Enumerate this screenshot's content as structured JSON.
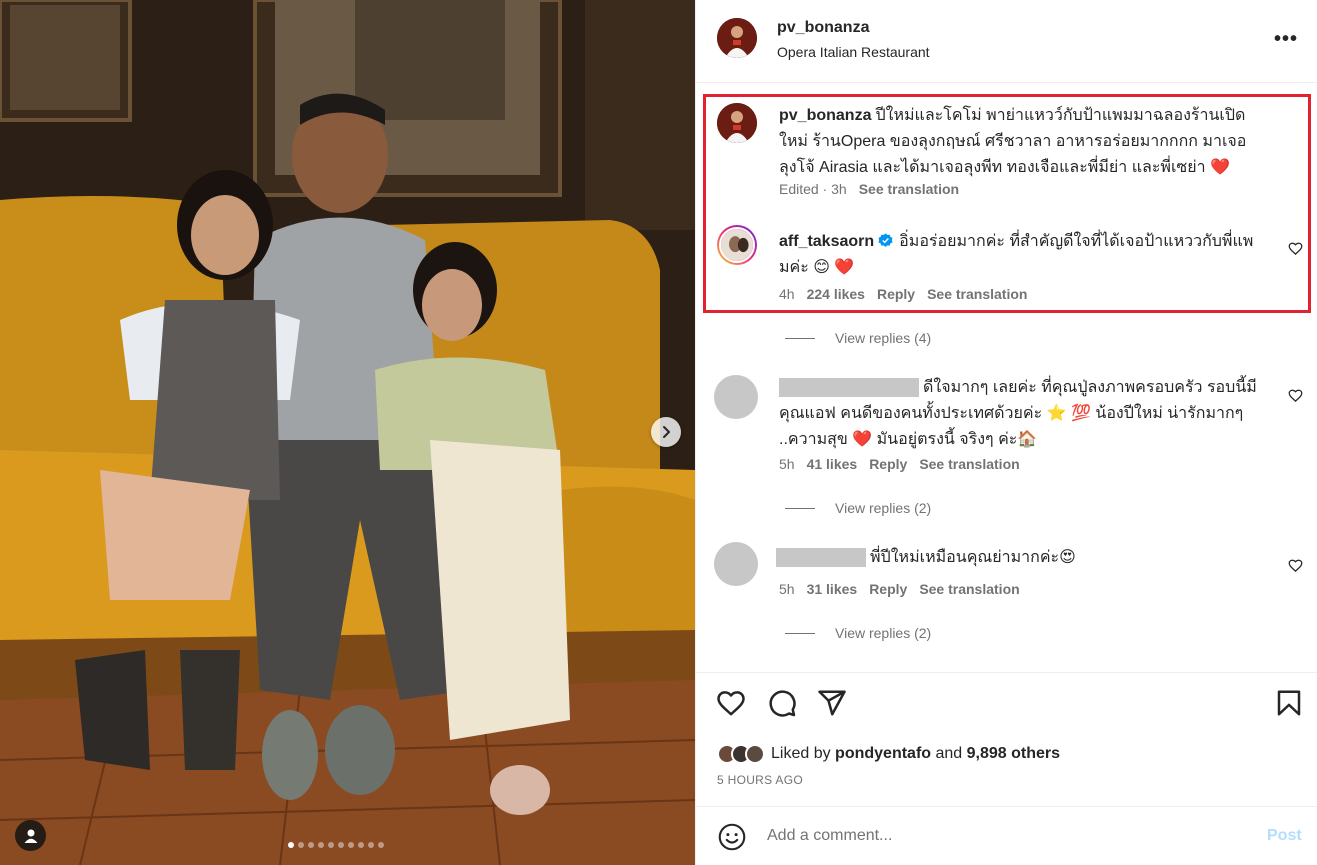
{
  "post": {
    "username": "pv_bonanza",
    "location": "Opera Italian Restaurant",
    "more_label": "•••"
  },
  "caption": {
    "username": "pv_bonanza",
    "text": "ปีใหม่และโคโม่ พาย่าแหวว์กับป้าแพมมาฉลองร้านเปิดใหม่ ร้านOpera ของลุงกฤษณ์ ศรีชวาลา อาหารอร่อยมากกกก มาเจอลุงโจ้ Airasia และได้มาเจอลุงพีท ทองเจือและพี่มีย่า และพี่เซย่า ❤️",
    "edited": "Edited · 3h",
    "translate": "See translation"
  },
  "comments": [
    {
      "username": "aff_taksaorn",
      "verified": true,
      "text": "อิ่มอร่อยมากค่ะ ที่สำคัญดีใจที่ได้เจอป้าแหววกับพี่แพมค่ะ 😊 ❤️",
      "time": "4h",
      "likes": "224 likes",
      "reply": "Reply",
      "translate": "See translation",
      "view_replies": "View replies (4)"
    },
    {
      "username": "",
      "text": "ดีใจมากๆ เลยค่ะ ที่คุณปู่ลงภาพครอบครัว รอบนี้มีคุณแอฟ คนดีของคนทั้งประเทศด้วยค่ะ ⭐ 💯 น้องปีใหม่ น่ารักมากๆ ..ความสุข ❤️ มันอยู่ตรงนี้ จริงๆ ค่ะ🏠",
      "time": "5h",
      "likes": "41 likes",
      "reply": "Reply",
      "translate": "See translation",
      "view_replies": "View replies (2)"
    },
    {
      "username": "",
      "text": "พี่ปีใหม่เหมือนคุณย่ามากค่ะ😍",
      "time": "5h",
      "likes": "31 likes",
      "reply": "Reply",
      "translate": "See translation",
      "view_replies": "View replies (2)"
    }
  ],
  "likes": {
    "liked_by_prefix": "Liked by",
    "liked_by_user": "pondyentafo",
    "and": "and",
    "others": "9,898 others"
  },
  "time_ago": "5 HOURS AGO",
  "add_comment": {
    "placeholder": "Add a comment...",
    "post_label": "Post"
  },
  "carousel": {
    "count": 10,
    "active_index": 0
  },
  "colors": {
    "highlight": "#e0232f",
    "verified": "#0095f6",
    "post_disabled": "#b2dffc",
    "text_secondary": "#737373"
  }
}
